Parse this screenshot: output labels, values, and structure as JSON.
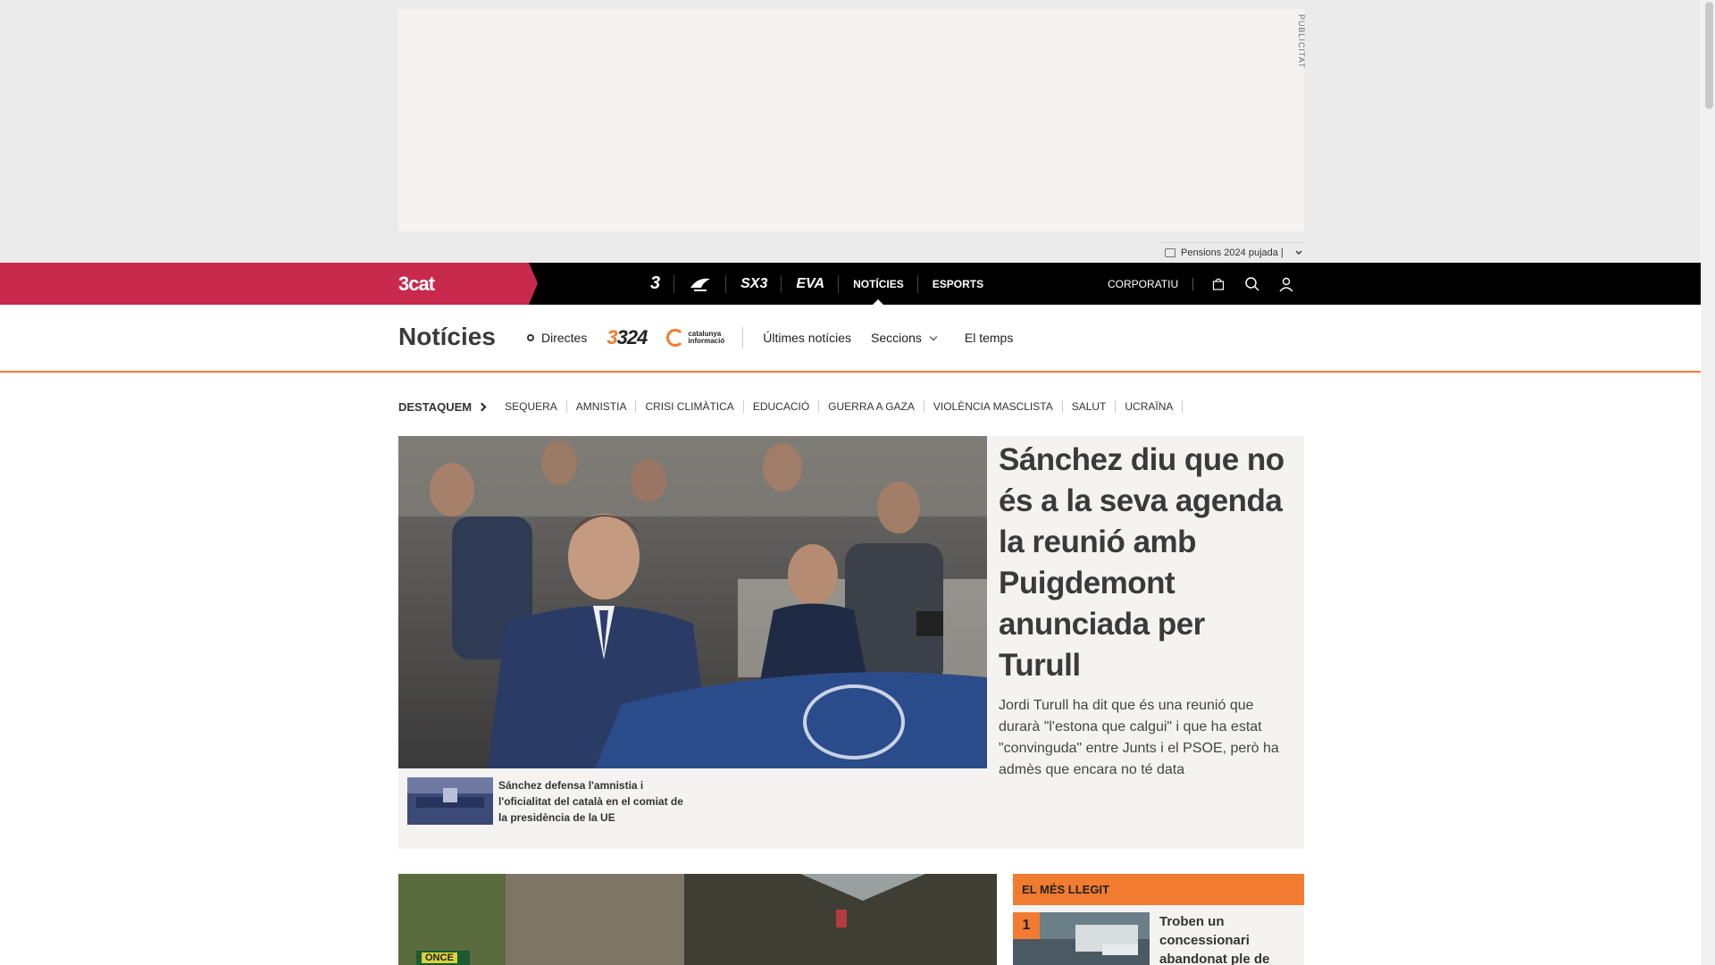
{
  "ad": {
    "label": "PUBLICITAT"
  },
  "trend": {
    "label": "Pensions 2024 pujada |"
  },
  "navbar": {
    "brand": "3cat",
    "items": [
      {
        "label": "3",
        "logo": true
      },
      {
        "label": "Cat Ràdio",
        "logo": true
      },
      {
        "label": "SX3",
        "logo": true
      },
      {
        "label": "EVA",
        "logo": true
      },
      {
        "label": "NOTÍCIES",
        "active": true
      },
      {
        "label": "ESPORTS"
      }
    ],
    "corporate": "CORPORATIU"
  },
  "subheader": {
    "title": "Notícies",
    "live": "Directes",
    "logo_324": "324",
    "logo_cat_info_line1": "catalunya",
    "logo_cat_info_line2": "informació",
    "links": [
      "Últimes notícies",
      "Seccions",
      "El temps"
    ]
  },
  "tags": {
    "lead": "DESTAQUEM",
    "items": [
      "SEQUERA",
      "AMNISTIA",
      "CRISI CLIMÀTICA",
      "EDUCACIÓ",
      "GUERRA A GAZA",
      "VIOLÈNCIA MASCLISTA",
      "SALUT",
      "UCRAÏNA"
    ]
  },
  "feature": {
    "headline": "Sánchez diu que no és a la seva agenda la reunió amb Puigdemont anunciada per Turull",
    "summary": "Jordi Turull ha dit que és una reunió que durarà \"l'estona que calgui\" i que ha estat \"convinguda\" entre Junts i el PSOE, però ha admès que encara no té data",
    "related": "Sánchez defensa l'amnistia i l'oficialitat del català en el comiat de la presidència de la UE"
  },
  "second": {
    "sign": "ONCE"
  },
  "most_read": {
    "header": "EL MÉS LLEGIT",
    "items": [
      {
        "rank": "1",
        "title": "Troben un concessionari abandonat ple de"
      }
    ]
  },
  "colors": {
    "brand": "#c8294d",
    "accent": "#f07b31",
    "nav_bg": "#000000"
  }
}
